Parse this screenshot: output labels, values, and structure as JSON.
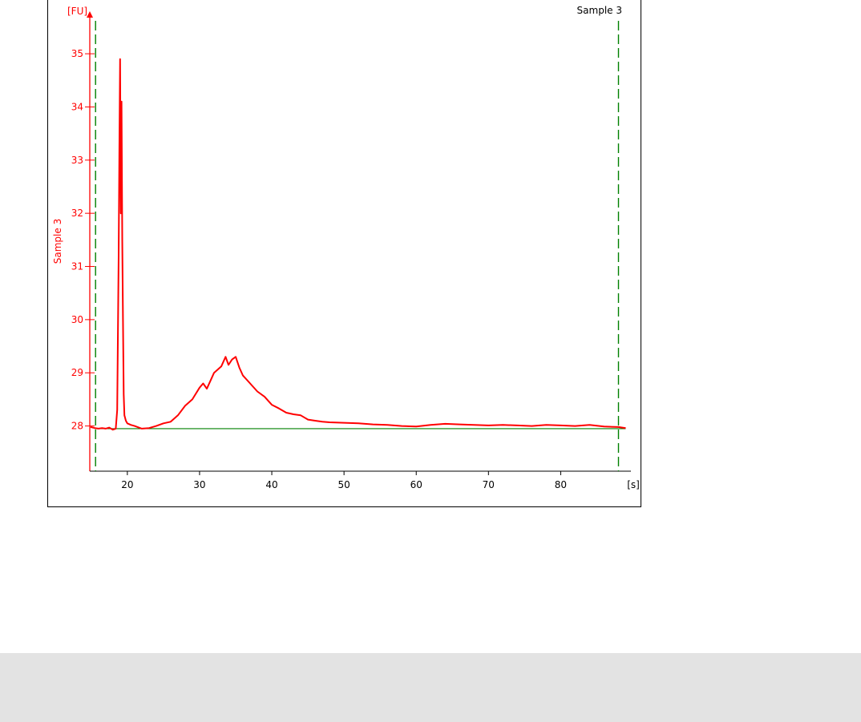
{
  "chart_data": {
    "type": "line",
    "title": "Sample 3",
    "y_unit": "[FU]",
    "x_unit": "[s]",
    "ylabel": "Sample 3",
    "xlim": [
      14.8,
      89.5
    ],
    "ylim": [
      27.15,
      35.8
    ],
    "x_ticks": [
      20,
      30,
      40,
      50,
      60,
      70,
      80
    ],
    "y_ticks": [
      28,
      29,
      30,
      31,
      32,
      33,
      34,
      35
    ],
    "grid": false,
    "colors": {
      "trace": "#ff0000",
      "axis": "#ff0000",
      "baseline": "#008000",
      "markers": "#008000"
    },
    "baseline": {
      "x_start": 15.5,
      "x_end": 89.0,
      "y": 27.95
    },
    "markers": [
      {
        "x": 15.6
      },
      {
        "x": 88.0
      }
    ],
    "series": [
      {
        "x": [
          14.9,
          15.5,
          16.0,
          16.5,
          17.0,
          17.5,
          18.0,
          18.4,
          18.6,
          18.8,
          18.9,
          19.0,
          19.1,
          19.2,
          19.3,
          19.4,
          19.5,
          19.6,
          19.8,
          20.0,
          20.5,
          21.0,
          22.0,
          23.0,
          24.0,
          25.0,
          26.0,
          27.0,
          28.0,
          29.0,
          30.0,
          30.5,
          31.0,
          31.5,
          32.0,
          33.0,
          33.6,
          34.0,
          34.5,
          35.0,
          35.5,
          36.0,
          37.0,
          38.0,
          39.0,
          40.0,
          41.0,
          42.0,
          43.0,
          44.0,
          45.0,
          46.0,
          47.0,
          48.0,
          50.0,
          52.0,
          54.0,
          56.0,
          58.0,
          60.0,
          62.0,
          64.0,
          66.0,
          68.0,
          70.0,
          72.0,
          74.0,
          76.0,
          78.0,
          80.0,
          82.0,
          84.0,
          86.0,
          88.0,
          89.0
        ],
        "y": [
          27.98,
          27.96,
          27.95,
          27.96,
          27.95,
          27.97,
          27.93,
          27.95,
          28.3,
          31.2,
          33.2,
          34.9,
          32.0,
          34.1,
          31.5,
          30.0,
          28.6,
          28.2,
          28.1,
          28.05,
          28.02,
          28.0,
          27.95,
          27.96,
          28.0,
          28.05,
          28.08,
          28.2,
          28.38,
          28.5,
          28.72,
          28.8,
          28.7,
          28.85,
          29.0,
          29.12,
          29.3,
          29.15,
          29.25,
          29.3,
          29.1,
          28.95,
          28.8,
          28.65,
          28.55,
          28.4,
          28.33,
          28.25,
          28.22,
          28.2,
          28.12,
          28.1,
          28.08,
          28.07,
          28.06,
          28.05,
          28.03,
          28.02,
          28.0,
          27.99,
          28.02,
          28.04,
          28.03,
          28.02,
          28.01,
          28.02,
          28.01,
          28.0,
          28.02,
          28.01,
          28.0,
          28.02,
          27.99,
          27.98,
          27.96
        ]
      }
    ]
  }
}
